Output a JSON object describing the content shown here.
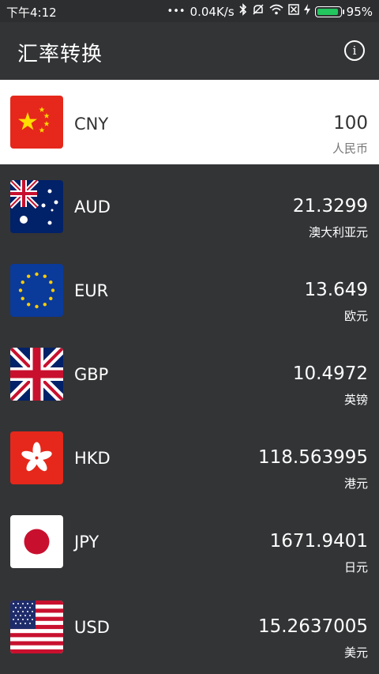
{
  "status": {
    "time": "下午4:12",
    "speed": "0.04K/s",
    "battery": "95%"
  },
  "appbar": {
    "title": "汇率转换",
    "info_icon_label": "i"
  },
  "base": {
    "code": "CNY",
    "amount": "100",
    "name": "人民币",
    "flag": "china-flag-icon"
  },
  "rates": [
    {
      "code": "AUD",
      "amount": "21.3299",
      "name": "澳大利亚元",
      "flag": "australia-flag-icon"
    },
    {
      "code": "EUR",
      "amount": "13.649",
      "name": "欧元",
      "flag": "eu-flag-icon"
    },
    {
      "code": "GBP",
      "amount": "10.4972",
      "name": "英镑",
      "flag": "uk-flag-icon"
    },
    {
      "code": "HKD",
      "amount": "118.563995",
      "name": "港元",
      "flag": "hongkong-flag-icon"
    },
    {
      "code": "JPY",
      "amount": "1671.9401",
      "name": "日元",
      "flag": "japan-flag-icon"
    },
    {
      "code": "USD",
      "amount": "15.2637005",
      "name": "美元",
      "flag": "usa-flag-icon"
    }
  ],
  "colors": {
    "background": "#333436",
    "base_row": "#ffffff",
    "battery": "#22c55e"
  }
}
